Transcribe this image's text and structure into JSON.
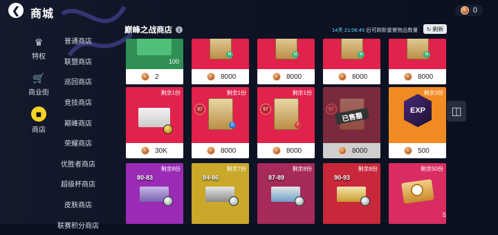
{
  "header": {
    "back_icon": "back-arrow-icon",
    "title": "商城",
    "coin_amount": "0"
  },
  "rail": [
    {
      "label": "特权",
      "icon": "crown-icon",
      "active": false
    },
    {
      "label": "商业街",
      "icon": "cart-icon",
      "active": false
    },
    {
      "label": "商店",
      "icon": "shop-icon",
      "active": true
    }
  ],
  "subnav": [
    "普通商店",
    "联盟商店",
    "巡回商店",
    "竞技商店",
    "巅峰商店",
    "荣耀商店",
    "优胜者商店",
    "超级杯商店",
    "皮肤商店",
    "联赛积分商店"
  ],
  "section": {
    "title": "巅峰之战商店",
    "refresh_time": "14天 21:06:45",
    "refresh_text": "后可刷新重置物品数量",
    "refresh_button": "刷新"
  },
  "cards": [
    {
      "price": "2",
      "remaining": "",
      "tag": "100",
      "bg": "#2f8f55"
    },
    {
      "price": "8000",
      "remaining": "",
      "bg": "#e0224c"
    },
    {
      "price": "8000",
      "remaining": "",
      "bg": "#e0224c"
    },
    {
      "price": "8000",
      "remaining": "",
      "bg": "#e0224c"
    },
    {
      "price": "8000",
      "remaining": "",
      "bg": "#e0224c"
    },
    {
      "price": "30K",
      "remaining": "剩余1份",
      "bg": "#e0224c"
    },
    {
      "price": "8000",
      "remaining": "剩余1份",
      "ovr": "97",
      "bg": "#e0224c"
    },
    {
      "price": "8000",
      "remaining": "剩余1份",
      "ovr": "97",
      "bg": "#e0224c"
    },
    {
      "price": "8000",
      "remaining": "",
      "ovr": "97",
      "sold": "已售罄",
      "bg": "#7a2a3c"
    },
    {
      "price": "500",
      "remaining": "剩余3份",
      "exp": "EXP",
      "bg": "#f08a22"
    },
    {
      "price": "",
      "remaining": "剩余8份",
      "pack": "80-83",
      "bg": "#9a2bb5"
    },
    {
      "price": "",
      "remaining": "剩余7份",
      "pack": "84-86",
      "bg": "#c9a82a"
    },
    {
      "price": "",
      "remaining": "剩余8份",
      "pack": "87-89",
      "bg": "#a62a5a"
    },
    {
      "price": "",
      "remaining": "剩余8份",
      "pack": "90-93",
      "bg": "#c8283a"
    },
    {
      "price": "",
      "remaining": "剩余50份",
      "bg": "#d92d62"
    }
  ],
  "page_num": "5",
  "colors": {
    "accent": "#f5d229",
    "coin": "#b0552a"
  }
}
